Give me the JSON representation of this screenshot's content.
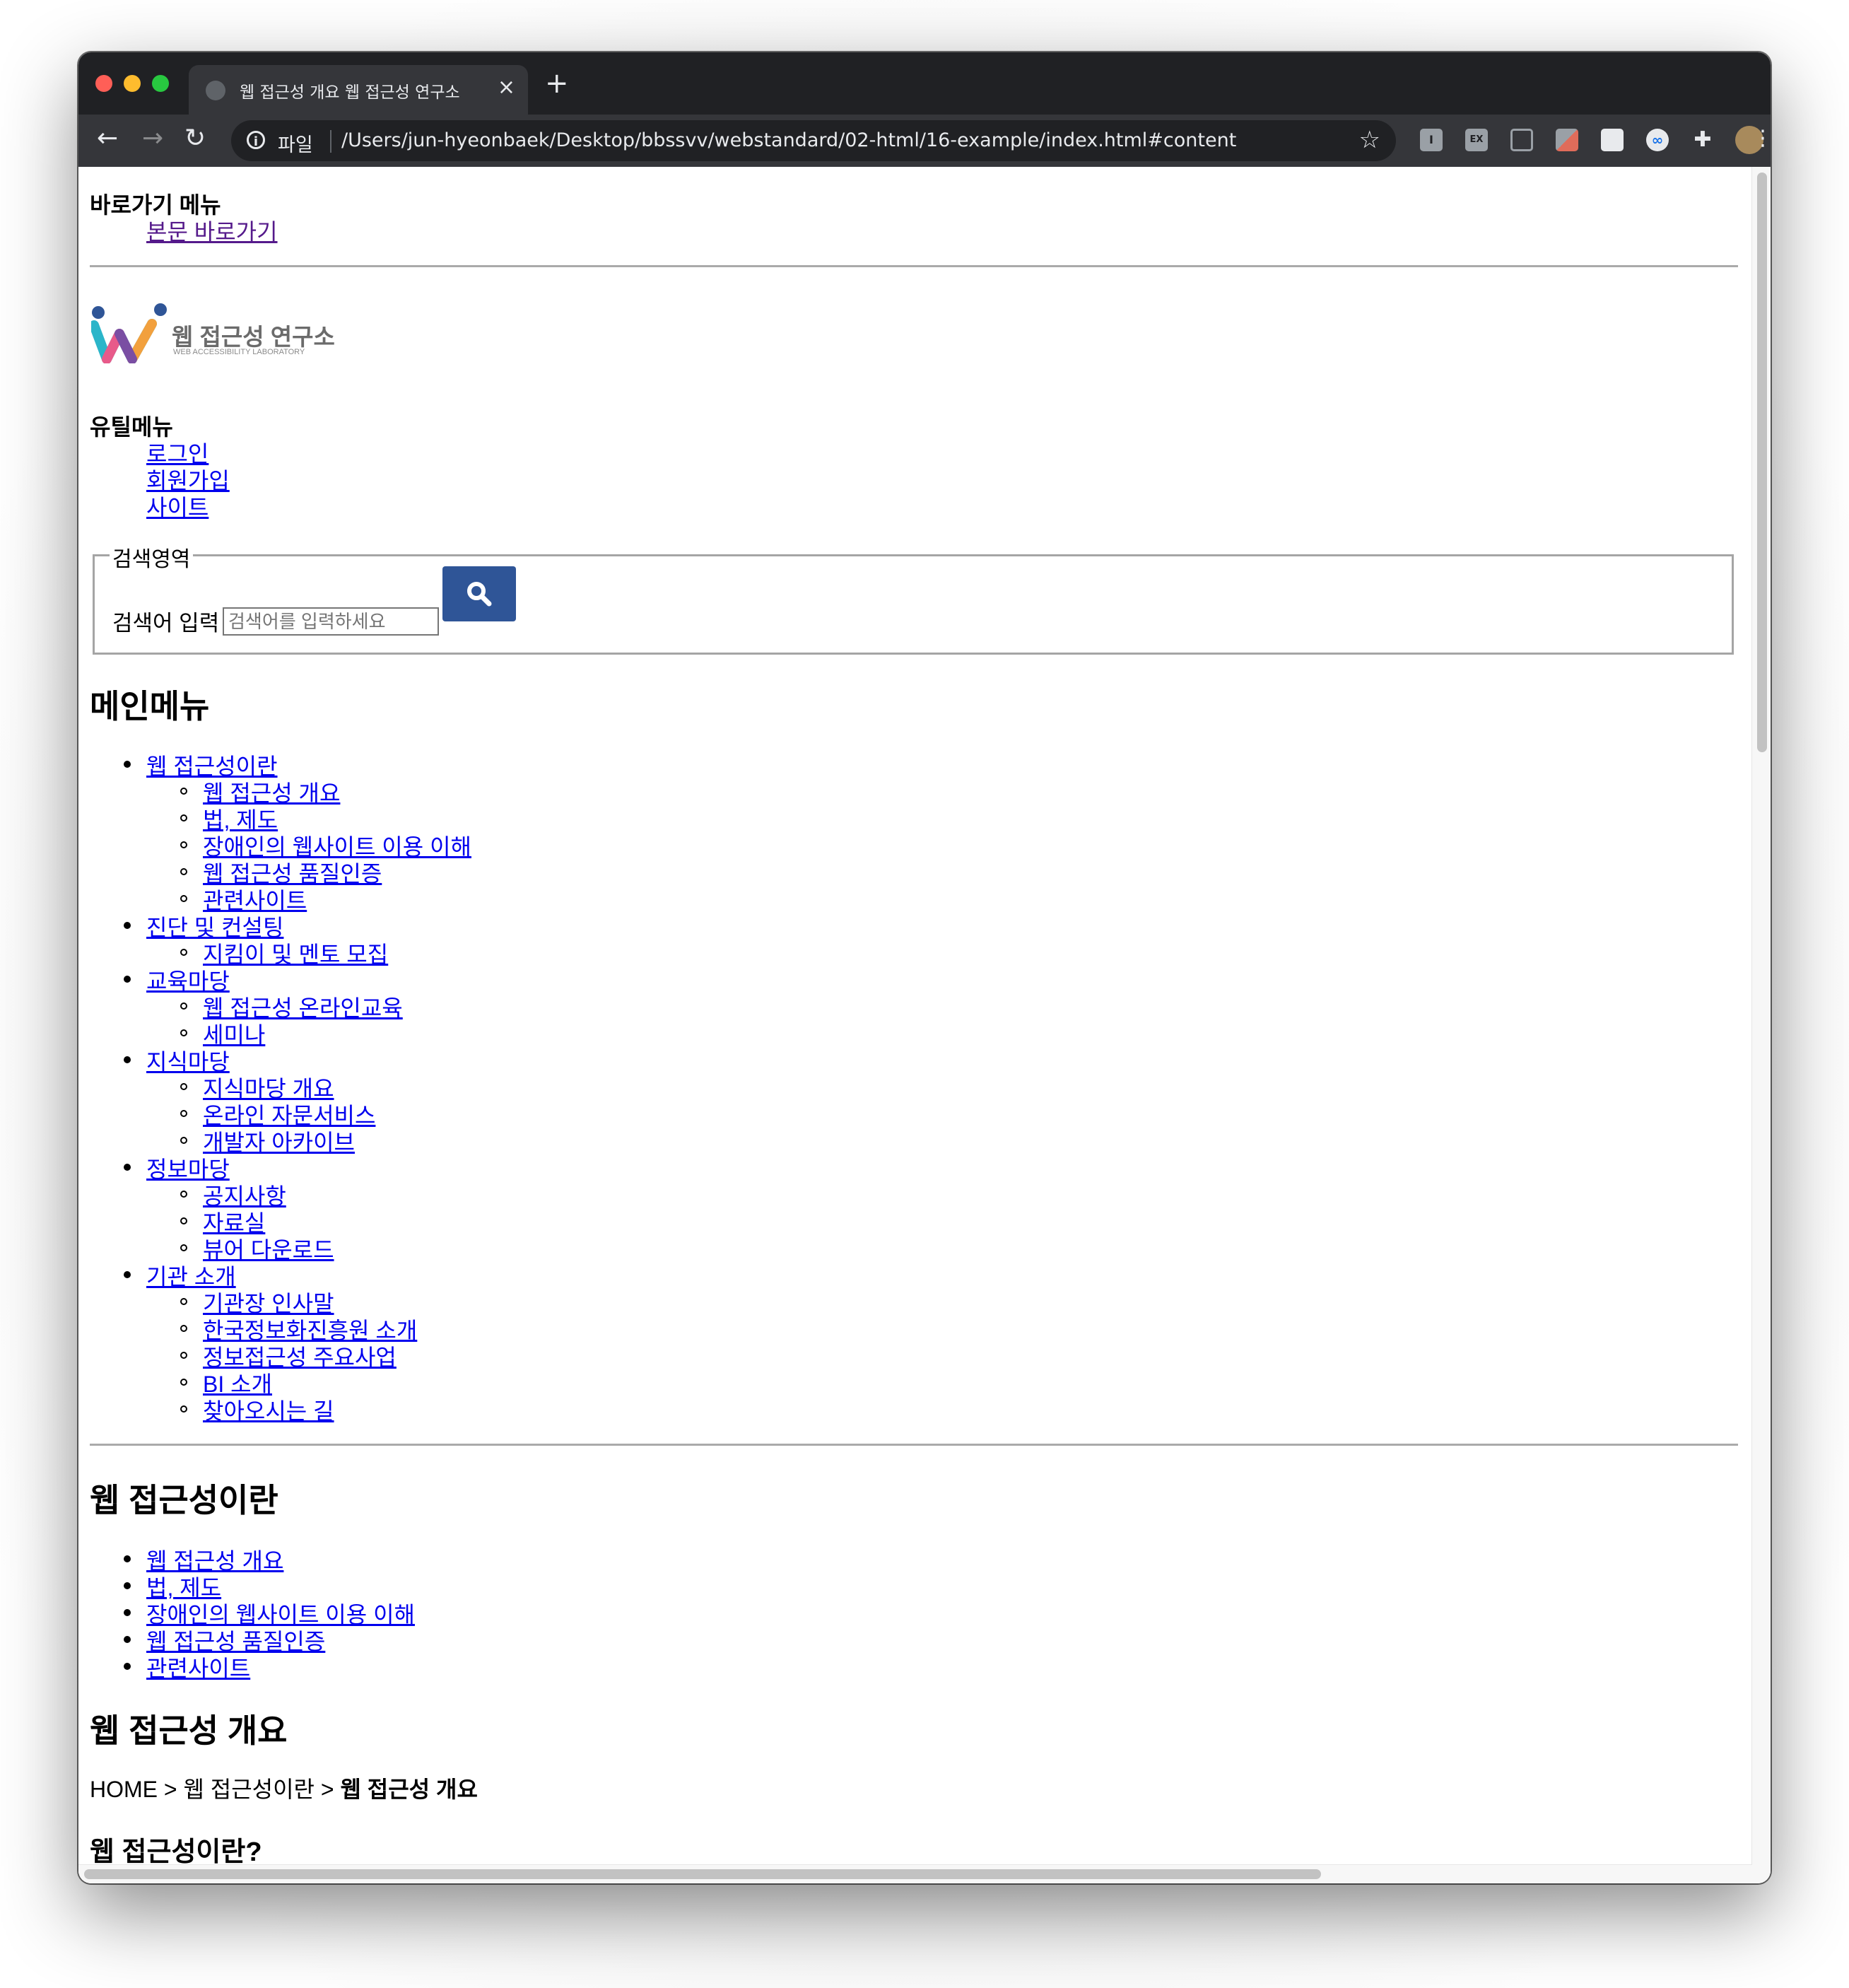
{
  "browser": {
    "tab_title": "웹 접근성 개요 웹 접근성 연구소",
    "tab_close": "×",
    "new_tab": "+",
    "scheme_label": "파일",
    "url": "/Users/jun-hyeonbaek/Desktop/bbssvv/webstandard/02-html/16-example/index.html#content",
    "ext_1": "I",
    "ext_2": "EX",
    "traffic_colors": [
      "#ff5f57",
      "#febc2e",
      "#28c840"
    ],
    "chrome_bg": "#202124",
    "toolbar_bg": "#35363a"
  },
  "skip": {
    "heading": "바로가기 메뉴",
    "link": "본문 바로가기"
  },
  "logo": {
    "name_ko": "웹 접근성 연구소",
    "name_en": "WEB ACCESSIBILITY LABORATORY"
  },
  "util": {
    "heading": "유틸메뉴",
    "items": [
      "로그인",
      "회원가입",
      "사이트"
    ]
  },
  "search": {
    "legend": "검색영역",
    "label": "검색어 입력",
    "placeholder": "검색어를 입력하세요",
    "button_color": "#2f5597"
  },
  "main_menu": {
    "heading": "메인메뉴",
    "items": [
      {
        "label": "웹 접근성이란",
        "children": [
          "웹 접근성 개요",
          "법, 제도",
          "장애인의 웹사이트 이용 이해",
          "웹 접근성 품질인증",
          "관련사이트"
        ]
      },
      {
        "label": "진단 및 컨설팅",
        "children": [
          "지킴이 및 멘토 모집"
        ]
      },
      {
        "label": "교육마당",
        "children": [
          "웹 접근성 온라인교육",
          "세미나"
        ]
      },
      {
        "label": "지식마당",
        "children": [
          "지식마당 개요",
          "온라인 자문서비스",
          "개발자 아카이브"
        ]
      },
      {
        "label": "정보마당",
        "children": [
          "공지사항",
          "자료실",
          "뷰어 다운로드"
        ]
      },
      {
        "label": "기관 소개",
        "children": [
          "기관장 인사말",
          "한국정보화진흥원 소개",
          "정보접근성 주요사업",
          "BI 소개",
          "찾아오시는 길"
        ]
      }
    ]
  },
  "sub_menu": {
    "heading": "웹 접근성이란",
    "items": [
      "웹 접근성 개요",
      "법, 제도",
      "장애인의 웹사이트 이용 이해",
      "웹 접근성 품질인증",
      "관련사이트"
    ]
  },
  "page": {
    "title": "웹 접근성 개요",
    "breadcrumb_home": "HOME",
    "breadcrumb_sep": ">",
    "breadcrumb_mid": "웹 접근성이란",
    "breadcrumb_current": "웹 접근성 개요",
    "section_heading": "웹 접근성이란?"
  }
}
